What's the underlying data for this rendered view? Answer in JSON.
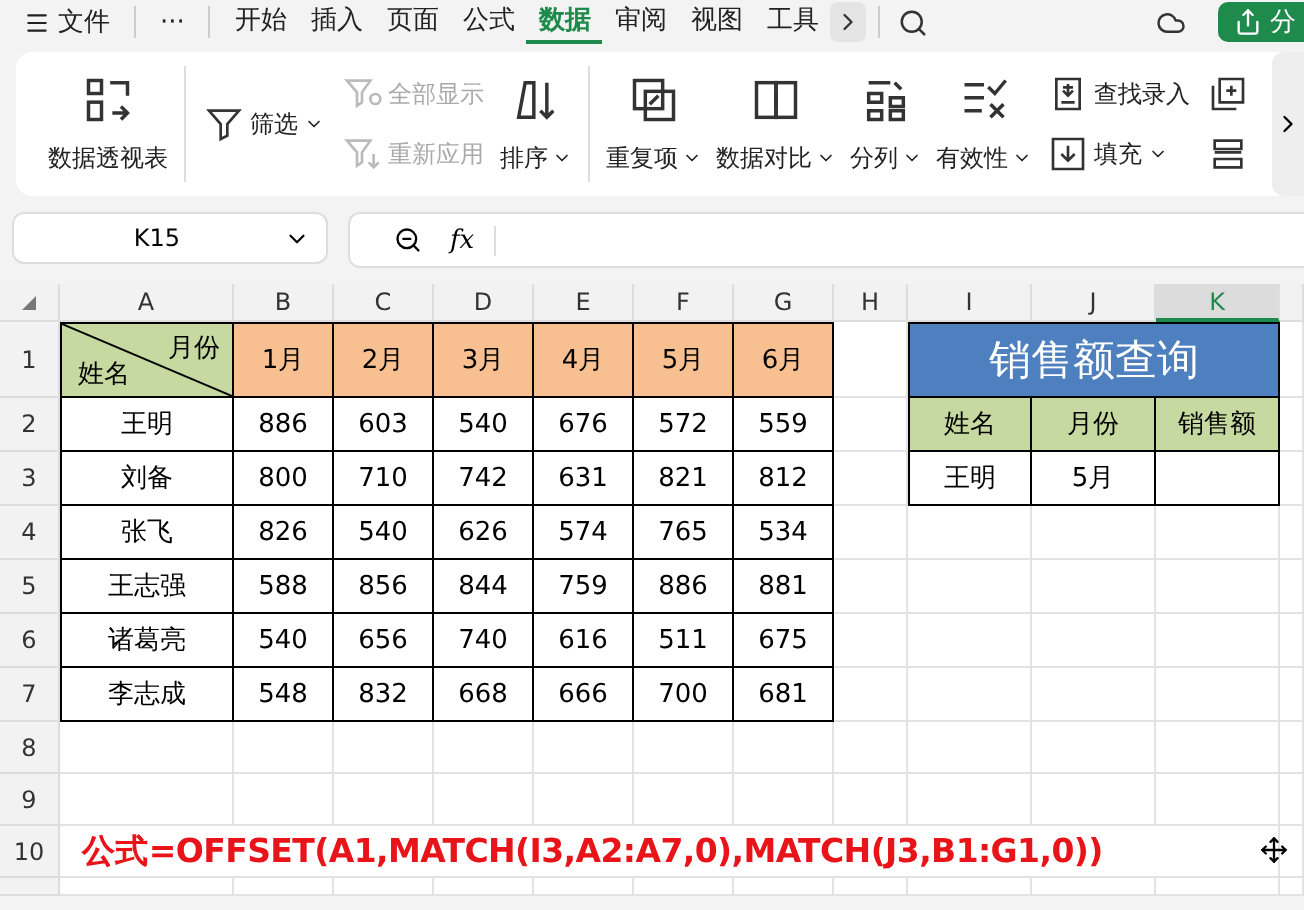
{
  "menu": {
    "file": "文件",
    "more": "···",
    "tabs": [
      {
        "label": "开始",
        "selected": false
      },
      {
        "label": "插入",
        "selected": false
      },
      {
        "label": "页面",
        "selected": false
      },
      {
        "label": "公式",
        "selected": false
      },
      {
        "label": "数据",
        "selected": true
      },
      {
        "label": "审阅",
        "selected": false
      },
      {
        "label": "视图",
        "selected": false
      },
      {
        "label": "工具",
        "selected": false
      }
    ],
    "share": "分"
  },
  "ribbon": {
    "groups": [
      [
        {
          "kind": "large",
          "label": "数据透视表",
          "dropdown": false,
          "disabled": false
        }
      ],
      [
        {
          "kind": "stack",
          "items": [
            {
              "label": "筛选",
              "dropdown": true,
              "disabled": false
            }
          ]
        },
        {
          "kind": "stack",
          "items": [
            {
              "label": "全部显示",
              "dropdown": false,
              "disabled": true
            },
            {
              "label": "重新应用",
              "dropdown": false,
              "disabled": true
            }
          ]
        },
        {
          "kind": "large",
          "label": "排序",
          "dropdown": true,
          "disabled": false
        }
      ],
      [
        {
          "kind": "large",
          "label": "重复项",
          "dropdown": true,
          "disabled": false
        },
        {
          "kind": "large",
          "label": "数据对比",
          "dropdown": true,
          "disabled": false
        },
        {
          "kind": "large",
          "label": "分列",
          "dropdown": true,
          "disabled": false
        },
        {
          "kind": "large",
          "label": "有效性",
          "dropdown": true,
          "disabled": false
        },
        {
          "kind": "stack",
          "items": [
            {
              "label": "查找录入",
              "dropdown": false,
              "disabled": false
            },
            {
              "label": "填充",
              "dropdown": true,
              "disabled": false
            }
          ]
        },
        {
          "kind": "stack",
          "items": [
            {
              "dropdown": false,
              "disabled": false
            },
            {
              "dropdown": false,
              "disabled": false
            }
          ]
        }
      ]
    ]
  },
  "formula_bar": {
    "name_box": "K15",
    "fx": "fx"
  },
  "sheet": {
    "columns": [
      {
        "label": "A",
        "selected": false
      },
      {
        "label": "B",
        "selected": false
      },
      {
        "label": "C",
        "selected": false
      },
      {
        "label": "D",
        "selected": false
      },
      {
        "label": "E",
        "selected": false
      },
      {
        "label": "F",
        "selected": false
      },
      {
        "label": "G",
        "selected": false
      },
      {
        "label": "H",
        "selected": false
      },
      {
        "label": "I",
        "selected": false
      },
      {
        "label": "J",
        "selected": false
      },
      {
        "label": "K",
        "selected": true
      }
    ],
    "rows": [
      "1",
      "2",
      "3",
      "4",
      "5",
      "6",
      "7",
      "8",
      "9",
      "10"
    ],
    "table": {
      "corner_top": "月份",
      "corner_bottom": "姓名",
      "months": [
        "1月",
        "2月",
        "3月",
        "4月",
        "5月",
        "6月"
      ],
      "rows": [
        {
          "name": "王明",
          "values": [
            "886",
            "603",
            "540",
            "676",
            "572",
            "559"
          ]
        },
        {
          "name": "刘备",
          "values": [
            "800",
            "710",
            "742",
            "631",
            "821",
            "812"
          ]
        },
        {
          "name": "张飞",
          "values": [
            "826",
            "540",
            "626",
            "574",
            "765",
            "534"
          ]
        },
        {
          "name": "王志强",
          "values": [
            "588",
            "856",
            "844",
            "759",
            "886",
            "881"
          ]
        },
        {
          "name": "诸葛亮",
          "values": [
            "540",
            "656",
            "740",
            "616",
            "511",
            "675"
          ]
        },
        {
          "name": "李志成",
          "values": [
            "548",
            "832",
            "668",
            "666",
            "700",
            "681"
          ]
        }
      ]
    },
    "lookup": {
      "title": "销售额查询",
      "headers": [
        "姓名",
        "月份",
        "销售额"
      ],
      "values": [
        "王明",
        "5月"
      ]
    },
    "note": "公式=OFFSET(A1,MATCH(I3,A2:A7,0),MATCH(J3,B1:G1,0))"
  }
}
